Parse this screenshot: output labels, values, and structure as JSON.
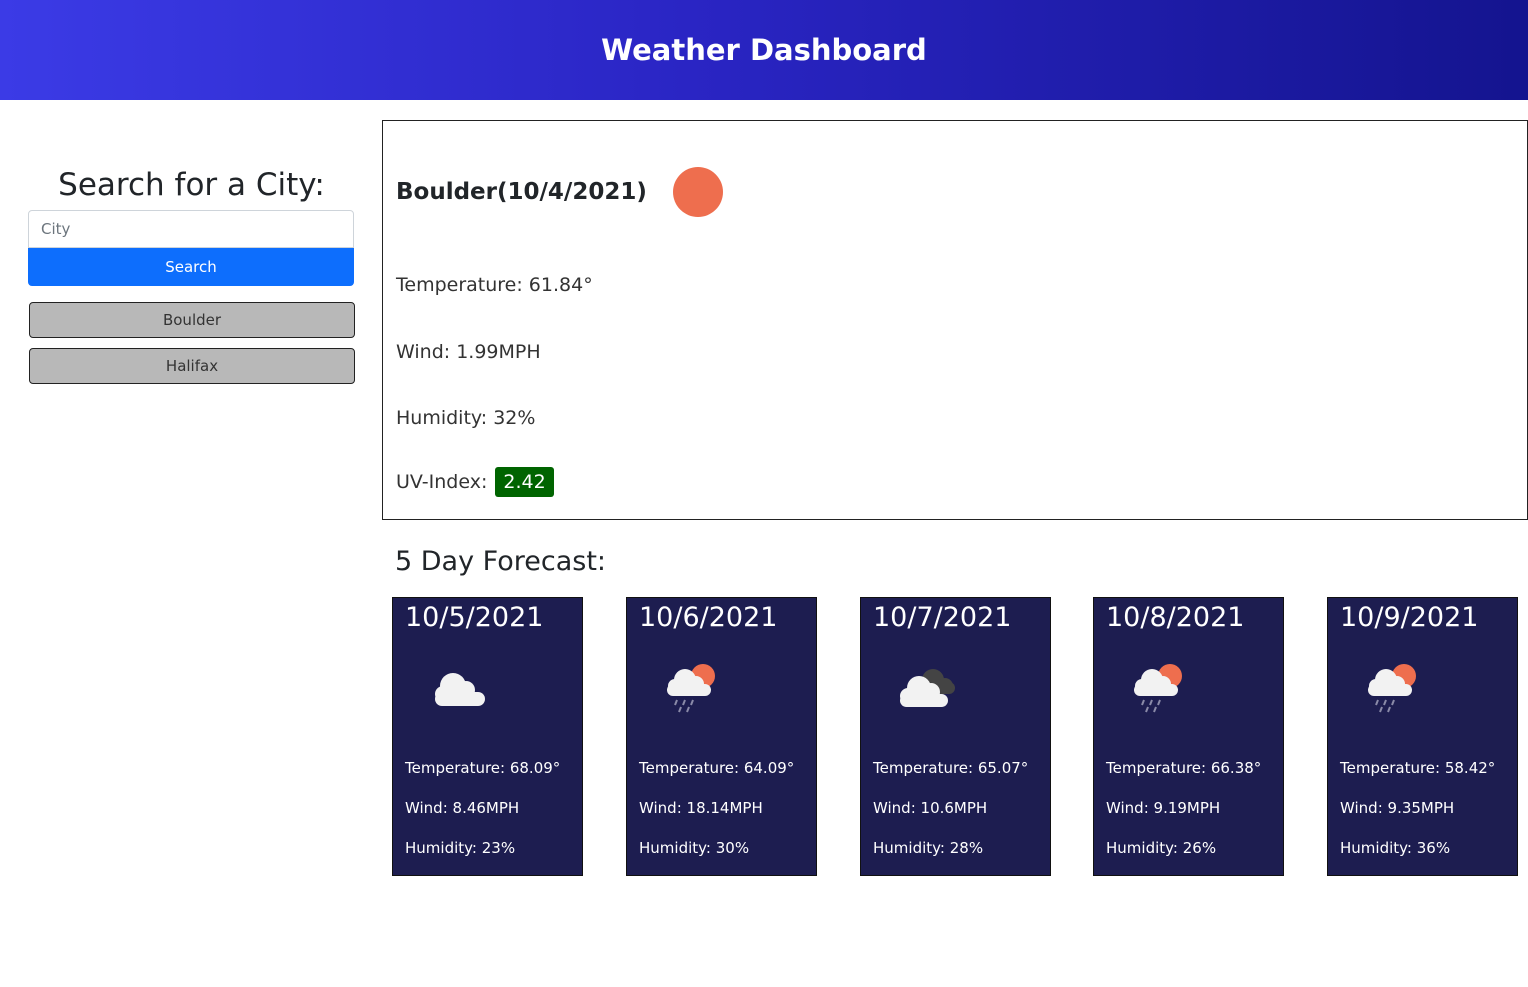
{
  "header": {
    "title": "Weather Dashboard"
  },
  "sidebar": {
    "heading": "Search for a City:",
    "input_placeholder": "City",
    "search_label": "Search",
    "history": [
      "Boulder",
      "Halifax"
    ]
  },
  "current": {
    "title": "Boulder(10/4/2021)",
    "icon": "sun-icon",
    "temperature": "Temperature: 61.84°",
    "wind": "Wind: 1.99MPH",
    "humidity": "Humidity: 32%",
    "uv_label": "UV-Index:",
    "uv_value": "2.42",
    "uv_color": "#006400"
  },
  "forecast": {
    "title": "5 Day Forecast:",
    "days": [
      {
        "date": "10/5/2021",
        "icon": "cloud-icon",
        "temperature": "Temperature: 68.09°",
        "wind": "Wind: 8.46MPH",
        "humidity": "Humidity: 23%"
      },
      {
        "date": "10/6/2021",
        "icon": "rain-sun-icon",
        "temperature": "Temperature: 64.09°",
        "wind": "Wind: 18.14MPH",
        "humidity": "Humidity: 30%"
      },
      {
        "date": "10/7/2021",
        "icon": "broken-clouds-icon",
        "temperature": "Temperature: 65.07°",
        "wind": "Wind: 10.6MPH",
        "humidity": "Humidity: 28%"
      },
      {
        "date": "10/8/2021",
        "icon": "rain-sun-icon",
        "temperature": "Temperature: 66.38°",
        "wind": "Wind: 9.19MPH",
        "humidity": "Humidity: 26%"
      },
      {
        "date": "10/9/2021",
        "icon": "rain-sun-icon",
        "temperature": "Temperature: 58.42°",
        "wind": "Wind: 9.35MPH",
        "humidity": "Humidity: 36%"
      }
    ]
  },
  "colors": {
    "header_start": "#3b3be6",
    "header_end": "#14148f",
    "card_bg": "#1d1d50",
    "search_btn": "#0d6efd",
    "sun": "#ee6e4e"
  }
}
